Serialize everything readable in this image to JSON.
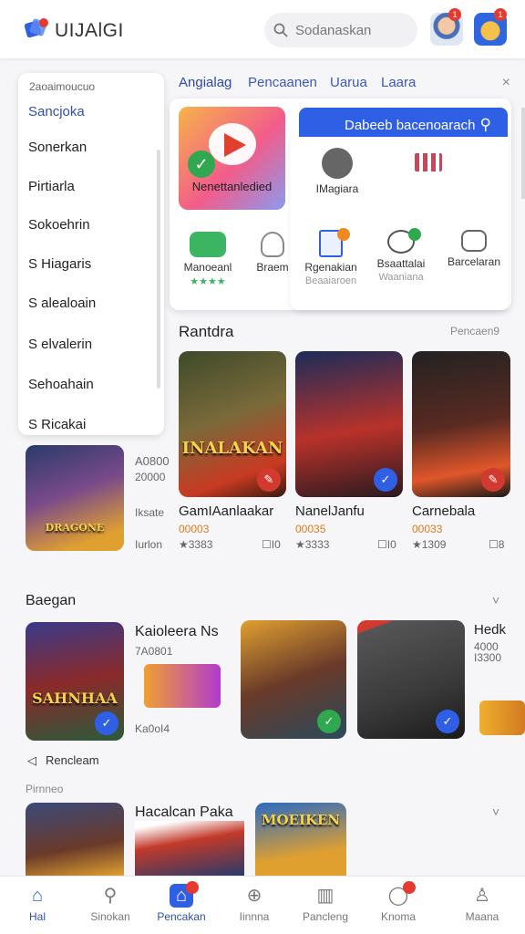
{
  "header": {
    "app_name": "UIJAlGI",
    "search_placeholder": "Sodanaskan",
    "notify1": "1",
    "notify2": "1"
  },
  "dropdown": {
    "heading": "2aoaimoucuo",
    "items": [
      "Sancjoka",
      "Sonerkan",
      "Pirtiarla",
      "Sokoehrin",
      "S Hiagaris",
      "S alealoain",
      "S elvalerin",
      "Sehoahain",
      "S Ricakai"
    ]
  },
  "tabs": {
    "items": [
      "Angialag",
      "Pencaanen",
      "Uarua",
      "Laara"
    ],
    "close": "×"
  },
  "feature": {
    "label": "Nenettanledied"
  },
  "primary_button": {
    "label": "Dabeeb bacenoarach"
  },
  "menu_items": [
    {
      "label": "IMagiara",
      "sub": ""
    },
    {
      "label": "",
      "sub": ""
    },
    {
      "label": "Manoeanl",
      "sub": "★★★★"
    },
    {
      "label": "Braem",
      "sub": ""
    },
    {
      "label": "Rgenakian",
      "sub": "Beaaiaroen"
    },
    {
      "label": "Bsaattalai",
      "sub": "Waaniana"
    },
    {
      "label": "Barcelaran",
      "sub": ""
    }
  ],
  "section1": {
    "title": "Rantdra",
    "more": "Pencaen9"
  },
  "games_row1": [
    {
      "name": "GamIAanlaakar",
      "meta": "00003",
      "rating": "★3383",
      "extra": "☐I0"
    },
    {
      "name": "NanelJanfu",
      "meta": "00035",
      "rating": "★3333",
      "extra": "☐I0"
    },
    {
      "name": "Carnebala",
      "meta": "00033",
      "rating": "★1309",
      "extra": "☐8"
    }
  ],
  "art_titles": {
    "g1": "INALAKAN",
    "g2": "",
    "g3": "",
    "s1": "DRAGONE",
    "s2": "SAHNHAA",
    "s3": "",
    "s4": ""
  },
  "side_game": {
    "meta1": "A0800",
    "meta2": "20000",
    "meta3": "Iksate",
    "meta4": "Iurlon"
  },
  "section2": {
    "title": "Baegan",
    "more": "˅"
  },
  "games_row2": [
    {
      "name": "Kaioleera Ns",
      "meta": "7A0801",
      "extra": "Ka0oI4"
    },
    {
      "name": "",
      "meta": "",
      "extra": ""
    },
    {
      "name": "",
      "meta": "",
      "extra": ""
    },
    {
      "name": "Hedk",
      "meta": "4000",
      "extra": "I3300"
    }
  ],
  "row2_link": {
    "label": "Rencleam"
  },
  "section3": {
    "title": "Pirnneo",
    "more": "˅",
    "game": "Hacalcan Paka",
    "art": "MOEIKEN"
  },
  "bottom_nav": [
    {
      "label": "Hal",
      "icon": "home"
    },
    {
      "label": "Sinokan",
      "icon": "search"
    },
    {
      "label": "Pencakan",
      "icon": "home-filled"
    },
    {
      "label": "Iinnna",
      "icon": "plus-circle"
    },
    {
      "label": "Pancleng",
      "icon": "map"
    },
    {
      "label": "Knoma",
      "icon": "chat"
    },
    {
      "label": "Maana",
      "icon": "user"
    }
  ],
  "colors": {
    "accent": "#2f5fe4",
    "badge": "#e63a2f",
    "green": "#2fa84f"
  }
}
